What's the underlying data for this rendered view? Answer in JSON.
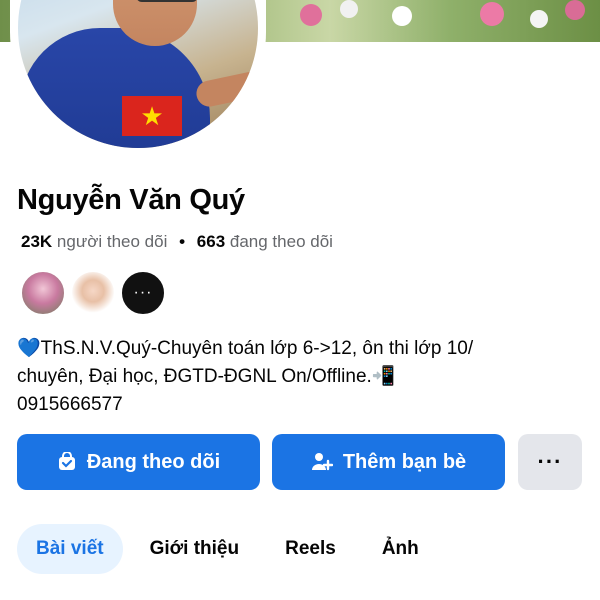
{
  "profile": {
    "name": "Nguyễn Văn Quý",
    "followers_count": "23K",
    "followers_label": "người theo dõi",
    "separator": "•",
    "following_count": "663",
    "following_label": "đang theo dõi",
    "bio_line1": "ThS.N.V.Quý-Chuyên toán lớp 6->12, ôn thi lớp 10/",
    "bio_line2": "chuyên, Đại học, ĐGTD-ĐGNL On/Offline.",
    "bio_line3": "0915666577",
    "bio_heart": "💙",
    "bio_phone_emoji": "📲"
  },
  "mutual_friends": {
    "more_label": "···"
  },
  "actions": {
    "following_label": "Đang theo dõi",
    "add_friend_label": "Thêm bạn bè",
    "more_label": "···",
    "following_icon": "follow-bag-icon",
    "add_friend_icon": "add-person-icon"
  },
  "tabs": [
    {
      "label": "Bài viết",
      "active": true
    },
    {
      "label": "Giới thiệu",
      "active": false
    },
    {
      "label": "Reels",
      "active": false
    },
    {
      "label": "Ảnh",
      "active": false
    }
  ],
  "colors": {
    "primary": "#1b74e4",
    "tab_active_bg": "#e7f3ff",
    "secondary_btn": "#e4e6eb",
    "muted_text": "#65676b"
  },
  "avatar_flag": "★"
}
